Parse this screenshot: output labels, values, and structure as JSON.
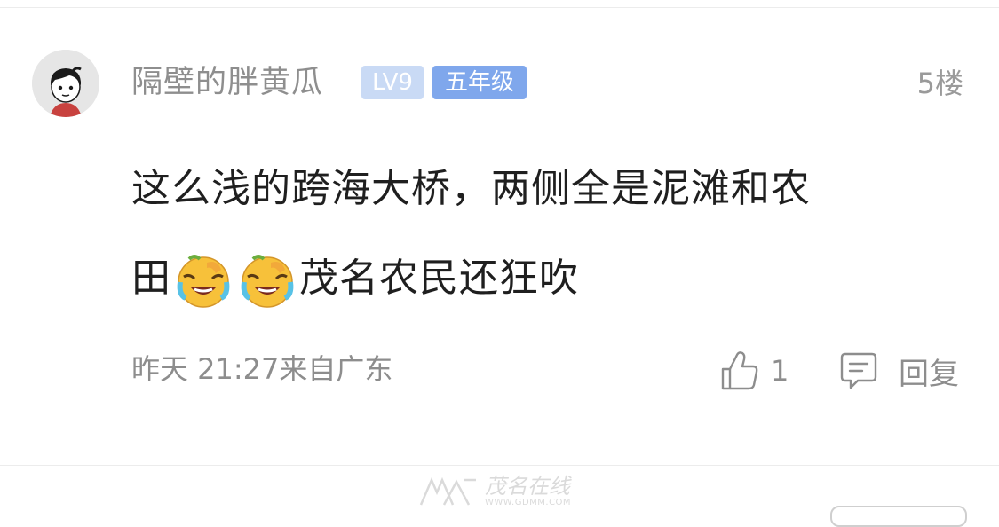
{
  "comment": {
    "username": "隔壁的胖黄瓜",
    "level_badge": "LV9",
    "grade_badge": "五年级",
    "floor": "5楼",
    "content_line1": "这么浅的跨海大桥，两侧全是泥滩和农",
    "content_line2_prefix": "田",
    "content_line2_suffix": "茂名农民还狂吹",
    "emojis": [
      "face-with-tears-of-joy-icon",
      "face-with-tears-of-joy-icon"
    ],
    "timestamp": "昨天 21:27来自广东",
    "likes": "1",
    "reply_label": "回复"
  },
  "watermark": {
    "title": "茂名在线",
    "url": "WWW.GDMM.COM"
  },
  "colors": {
    "level_badge_bg": "#c9daf5",
    "grade_badge_bg": "#7fa7ec",
    "text_primary": "#1f1f1f",
    "text_secondary": "#8e8e8e"
  }
}
